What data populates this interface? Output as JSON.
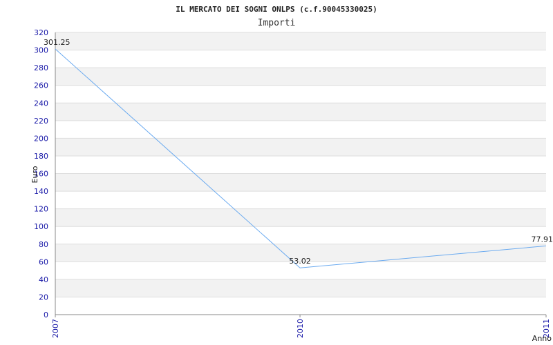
{
  "chart_data": {
    "type": "line",
    "title": "IL MERCATO DEI SOGNI ONLPS (c.f.90045330025)",
    "subtitle": "Importi",
    "xlabel": "Anno",
    "ylabel": "Euro",
    "categories": [
      "2007",
      "2010",
      "2011"
    ],
    "values": [
      301.25,
      53.02,
      77.91
    ],
    "data_labels": [
      "301.25",
      "53.02",
      "77.91"
    ],
    "ylim": [
      0,
      320
    ],
    "yticks": [
      "0",
      "20",
      "40",
      "60",
      "80",
      "100",
      "120",
      "140",
      "160",
      "180",
      "200",
      "220",
      "240",
      "260",
      "280",
      "300",
      "320"
    ],
    "grid": true,
    "colors": {
      "line": "#6aaaf0",
      "band": "#f2f2f2",
      "tick_text": "#1a1aa8"
    }
  }
}
